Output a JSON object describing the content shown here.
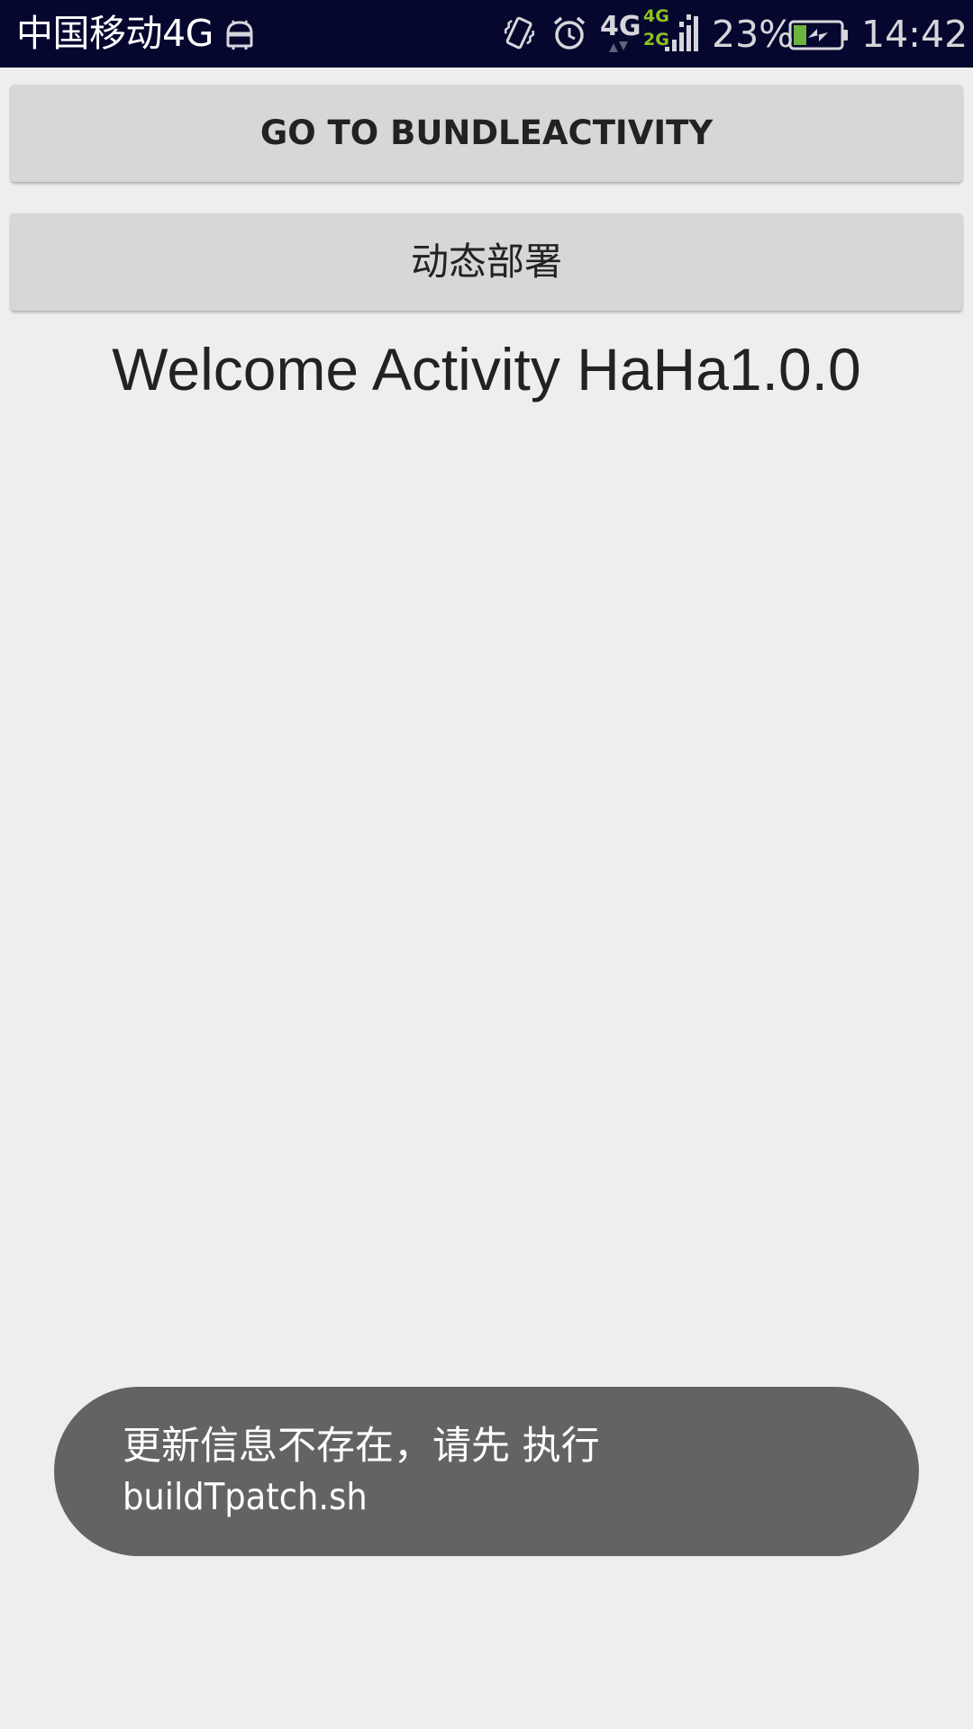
{
  "status_bar": {
    "carrier": "中国移动4G",
    "network": "4G",
    "network_secondary_top": "4G",
    "network_secondary_bottom": "2G",
    "battery_percent": "23%",
    "time": "14:42",
    "icons": [
      "android-debug-icon",
      "vibrate-icon",
      "alarm-icon",
      "data-arrows-icon",
      "signal-icon",
      "battery-charging-icon"
    ],
    "colors": {
      "background": "#05072e",
      "network_green": "#8ec21f",
      "battery_green": "#6db33f"
    }
  },
  "buttons": {
    "bundle_label": "GO TO BUNDLEACTIVITY",
    "deploy_label": "动态部署"
  },
  "main": {
    "welcome_text": "Welcome Activity HaHa1.0.0"
  },
  "toast": {
    "line1": "更新信息不存在，请先 执行",
    "line2": "buildTpatch.sh"
  }
}
